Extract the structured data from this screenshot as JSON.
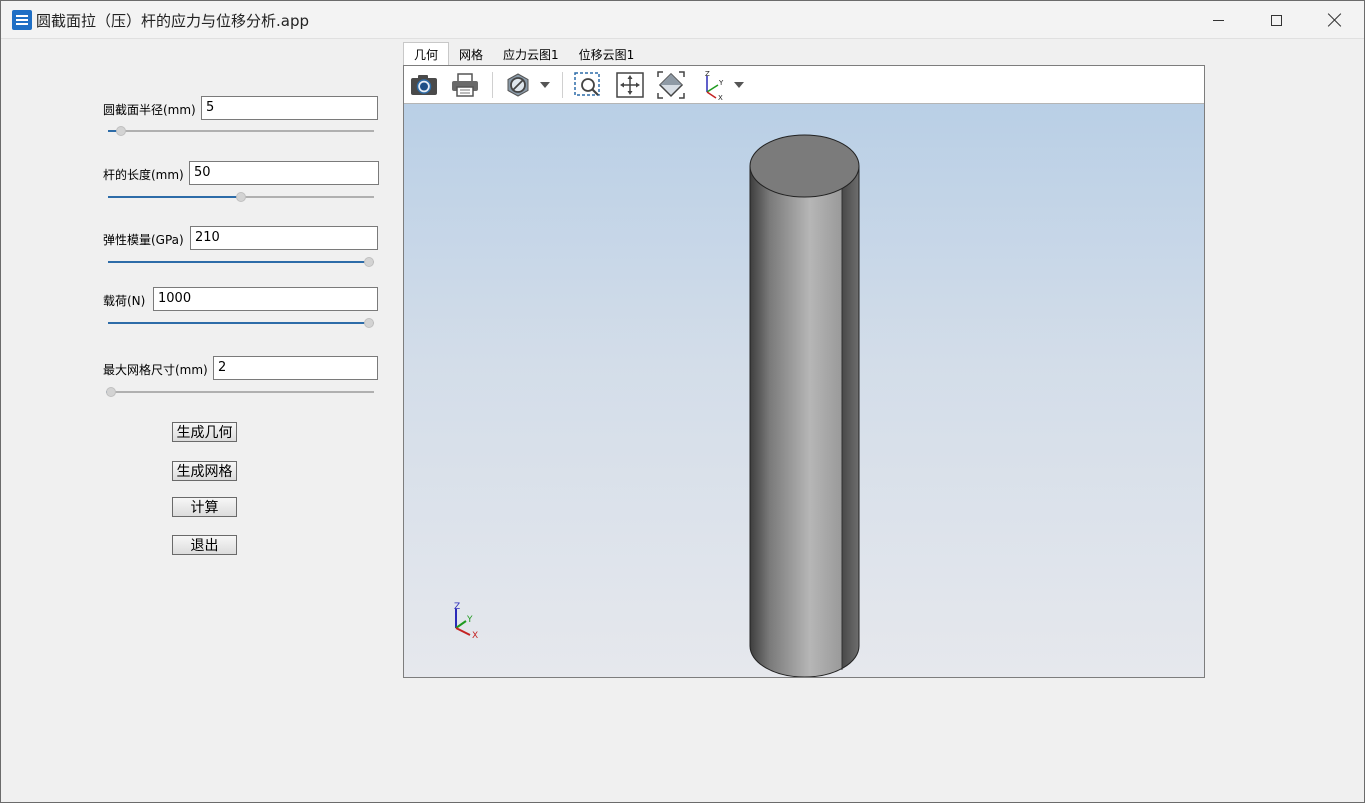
{
  "window": {
    "title": "圆截面拉（压）杆的应力与位移分析.app"
  },
  "params": {
    "radius": {
      "label": "圆截面半径(mm)",
      "value": "5",
      "slider_fraction": 0.03
    },
    "length": {
      "label": "杆的长度(mm)",
      "value": "50",
      "slider_fraction": 0.5
    },
    "modulus": {
      "label": "弹性模量(GPa)",
      "value": "210",
      "slider_fraction": 1.0
    },
    "load": {
      "label": "载荷(N)",
      "value": "1000",
      "slider_fraction": 1.0
    },
    "mesh": {
      "label": "最大网格尺寸(mm)",
      "value": "2",
      "slider_fraction": 0.0
    }
  },
  "buttons": {
    "geometry": "生成几何",
    "mesh": "生成网格",
    "compute": "计算",
    "exit": "退出"
  },
  "tabs": [
    "几何",
    "网格",
    "应力云图1",
    "位移云图1"
  ],
  "active_tab": "几何",
  "toolbar": {
    "icons": [
      "camera-icon",
      "print-icon",
      "hide-icon",
      "zoom-box-icon",
      "zoom-extents-icon",
      "fit-view-icon",
      "axis-view-icon"
    ]
  },
  "triad": {
    "z": "Z",
    "y": "Y",
    "x": "X"
  },
  "colors": {
    "accent": "#2d6ca8",
    "viewer_bg_top": "#b9cfe6",
    "viewer_bg_bottom": "#e6e8ed"
  }
}
